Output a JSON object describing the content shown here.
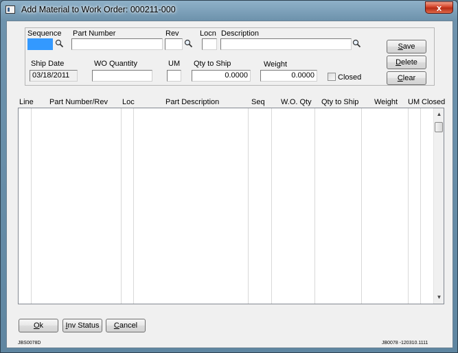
{
  "window": {
    "title": "Add Material to Work Order: 000211-000",
    "close_glyph": "x"
  },
  "form": {
    "sequence": {
      "label": "Sequence",
      "value": ""
    },
    "part_number": {
      "label": "Part Number",
      "value": ""
    },
    "rev": {
      "label": "Rev",
      "value": ""
    },
    "locn": {
      "label": "Locn",
      "value": ""
    },
    "description": {
      "label": "Description",
      "value": ""
    },
    "ship_date": {
      "label": "Ship Date",
      "value": "03/18/2011"
    },
    "wo_quantity": {
      "label": "WO Quantity",
      "value": ""
    },
    "um": {
      "label": "UM",
      "value": ""
    },
    "qty_to_ship": {
      "label": "Qty to Ship",
      "value": "0.0000"
    },
    "weight": {
      "label": "Weight",
      "value": "0.0000"
    },
    "closed": {
      "label": "Closed",
      "checked": false
    }
  },
  "side_buttons": {
    "save": {
      "label": "Save",
      "accel": "S",
      "rest": "ave"
    },
    "delete": {
      "label": "Delete",
      "accel": "D",
      "rest": "elete"
    },
    "clear": {
      "label": "Clear",
      "accel": "C",
      "rest": "lear"
    }
  },
  "grid": {
    "columns": [
      "Line",
      "Part Number/Rev",
      "Loc",
      "Part Description",
      "Seq",
      "W.O. Qty",
      "Qty to Ship",
      "Weight",
      "UM",
      "Closed"
    ],
    "rows": []
  },
  "bottom_buttons": {
    "ok": {
      "label": "Ok",
      "accel": "O",
      "rest": "k"
    },
    "inv_status": {
      "label": "Inv Status",
      "accel": "I",
      "rest": "nv Status"
    },
    "cancel": {
      "label": "Cancel",
      "accel": "C",
      "rest": "ancel"
    }
  },
  "footer": {
    "left": "JBS0078D",
    "right": "JB0078 -120310.1111"
  },
  "icons": {
    "app": "app-window-icon",
    "lookup": "magnifier-icon",
    "scroll_up": "scroll-up-arrow-icon",
    "scroll_down": "scroll-down-arrow-icon"
  },
  "colors": {
    "active_field": "#3399ff",
    "close_button": "#c8402a"
  }
}
